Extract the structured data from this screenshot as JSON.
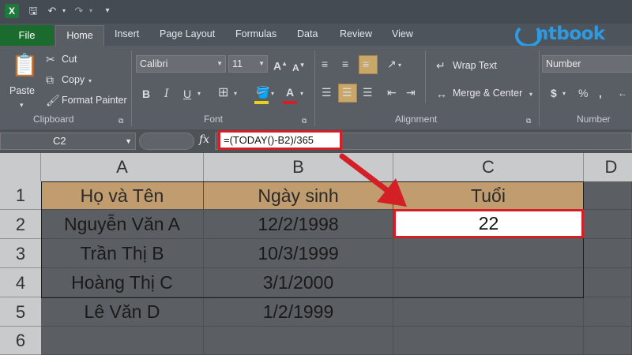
{
  "qat": {
    "app_icon": "excel-icon",
    "icons": [
      "save-icon",
      "undo-icon",
      "redo-icon",
      "customize-icon"
    ]
  },
  "tabs": [
    {
      "label": "File"
    },
    {
      "label": "Home"
    },
    {
      "label": "Insert"
    },
    {
      "label": "Page Layout"
    },
    {
      "label": "Formulas"
    },
    {
      "label": "Data"
    },
    {
      "label": "Review"
    },
    {
      "label": "View"
    }
  ],
  "brand": {
    "text": "ntbook"
  },
  "ribbon": {
    "clipboard": {
      "paste": "Paste",
      "cut": "Cut",
      "copy": "Copy",
      "format_painter": "Format Painter",
      "label": "Clipboard"
    },
    "font": {
      "name": "Calibri",
      "size": "11",
      "bold": "B",
      "italic": "I",
      "underline": "U",
      "font_color_letter": "A",
      "label": "Font"
    },
    "alignment": {
      "wrap": "Wrap Text",
      "merge": "Merge & Center",
      "label": "Alignment"
    },
    "number": {
      "format": "Number",
      "currency": "$",
      "percent": "%",
      "comma": ",",
      "label": "Number"
    }
  },
  "formula_bar": {
    "name_box": "C2",
    "fx": "fx",
    "formula": "=(TODAY()-B2)/365"
  },
  "columns": [
    "A",
    "B",
    "C",
    "D"
  ],
  "rows": [
    "1",
    "2",
    "3",
    "4",
    "5",
    "6"
  ],
  "table": {
    "headers": [
      "Họ và Tên",
      "Ngày sinh",
      "Tuổi"
    ],
    "data": [
      [
        "Nguyễn Văn A",
        "12/2/1998",
        "22"
      ],
      [
        "Trần Thị B",
        "10/3/1999",
        ""
      ],
      [
        "Hoàng Thị C",
        "3/1/2000",
        ""
      ],
      [
        "Lê Văn D",
        "1/2/1999",
        ""
      ]
    ]
  },
  "colors": {
    "highlight": "#d32027",
    "header_fill": "#c09c6e",
    "brand": "#2d9be3"
  }
}
